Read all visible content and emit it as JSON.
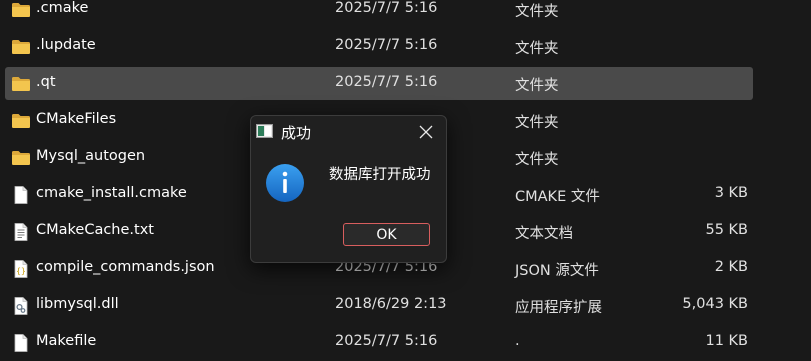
{
  "files": [
    {
      "name": ".cmake",
      "date": "2025/7/7 5:16",
      "type": "文件夹",
      "size": "",
      "icon": "folder-icon",
      "selected": false
    },
    {
      "name": ".lupdate",
      "date": "2025/7/7 5:16",
      "type": "文件夹",
      "size": "",
      "icon": "folder-icon",
      "selected": false
    },
    {
      "name": ".qt",
      "date": "2025/7/7 5:16",
      "type": "文件夹",
      "size": "",
      "icon": "folder-icon",
      "selected": true
    },
    {
      "name": "CMakeFiles",
      "date": "",
      "type": "文件夹",
      "size": "",
      "icon": "folder-icon",
      "selected": false
    },
    {
      "name": "Mysql_autogen",
      "date": "",
      "type": "文件夹",
      "size": "",
      "icon": "folder-icon",
      "selected": false
    },
    {
      "name": "cmake_install.cmake",
      "date": "",
      "type": "CMAKE 文件",
      "size": "3 KB",
      "icon": "file-icon",
      "selected": false
    },
    {
      "name": "CMakeCache.txt",
      "date": "",
      "type": "文本文档",
      "size": "55 KB",
      "icon": "text-file-icon",
      "selected": false
    },
    {
      "name": "compile_commands.json",
      "date": "2025/7/7 5:16",
      "type": "JSON 源文件",
      "size": "2 KB",
      "icon": "json-file-icon",
      "selected": false
    },
    {
      "name": "libmysql.dll",
      "date": "2018/6/29 2:13",
      "type": "应用程序扩展",
      "size": "5,043 KB",
      "icon": "dll-file-icon",
      "selected": false
    },
    {
      "name": "Makefile",
      "date": "2025/7/7 5:16",
      "type": ".",
      "size": "11 KB",
      "icon": "file-icon",
      "selected": false
    }
  ],
  "dialog": {
    "title": "成功",
    "message": "数据库打开成功",
    "ok_label": "OK",
    "icon": "info-icon"
  },
  "colors": {
    "background": "#191919",
    "selection": "#4a4a4a",
    "folder": "#f0c04c",
    "info_blue": "#1e88e5",
    "ok_border": "#d85e5e"
  }
}
